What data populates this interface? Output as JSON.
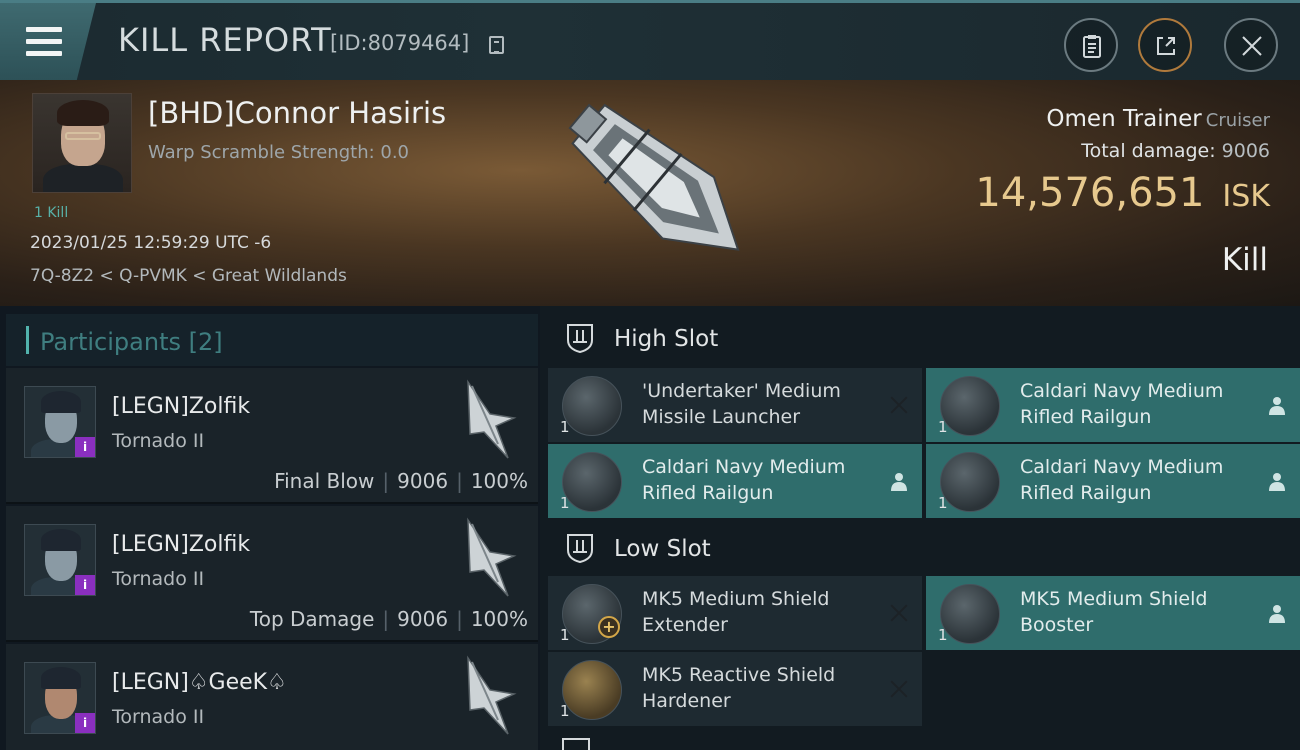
{
  "header": {
    "title": "KILL REPORT",
    "report_id": "[ID:8079464]",
    "icons": {
      "menu": "hamburger-icon",
      "copy": "copy-icon",
      "clipboard": "clipboard-icon",
      "share": "share-icon",
      "close": "close-icon"
    }
  },
  "victim": {
    "name": "[BHD]Connor Hasiris",
    "warp_scramble": "Warp Scramble Strength: 0.0",
    "kills": "1 Kill",
    "datetime": "2023/01/25 12:59:29 UTC -6",
    "location": "7Q-8Z2 < Q-PVMK < Great Wildlands",
    "ship_name": "Omen Trainer",
    "ship_class": "Cruiser",
    "total_damage_label": "Total damage:",
    "total_damage": "9006",
    "isk_value": "14,576,651",
    "isk_unit": "ISK",
    "result": "Kill"
  },
  "participants": {
    "label": "Participants",
    "count": "[2]",
    "rows": [
      {
        "name": "[LEGN]Zolfik",
        "ship": "Tornado II",
        "role": "Final Blow",
        "damage": "9006",
        "percent": "100%"
      },
      {
        "name": "[LEGN]Zolfik",
        "ship": "Tornado II",
        "role": "Top Damage",
        "damage": "9006",
        "percent": "100%"
      },
      {
        "name": "[LEGN]♤GeeK♤",
        "ship": "Tornado II"
      }
    ]
  },
  "fitting": {
    "high_slot": {
      "label": "High Slot",
      "modules": [
        {
          "name_line1": "'Undertaker' Medium",
          "name_line2": "Missile Launcher",
          "qty": "1",
          "state": "destroyed"
        },
        {
          "name_line1": "Caldari Navy Medium",
          "name_line2": "Rifled Railgun",
          "qty": "1",
          "state": "dropped"
        },
        {
          "name_line1": "Caldari Navy Medium",
          "name_line2": "Rifled Railgun",
          "qty": "1",
          "state": "dropped"
        },
        {
          "name_line1": "Caldari Navy Medium",
          "name_line2": "Rifled Railgun",
          "qty": "1",
          "state": "dropped"
        }
      ]
    },
    "low_slot": {
      "label": "Low Slot",
      "modules": [
        {
          "name_line1": "MK5 Medium Shield",
          "name_line2": "Extender",
          "qty": "1",
          "state": "destroyed"
        },
        {
          "name_line1": "MK5 Medium Shield",
          "name_line2": "Booster",
          "qty": "1",
          "state": "dropped"
        },
        {
          "name_line1": "MK5 Reactive Shield",
          "name_line2": "Hardener",
          "qty": "1",
          "state": "destroyed"
        }
      ]
    }
  },
  "colors": {
    "accent": "#52b3ad",
    "isk": "#e7c98e",
    "highlight": "#2f6d6c",
    "badge": "#8a2fbf"
  }
}
